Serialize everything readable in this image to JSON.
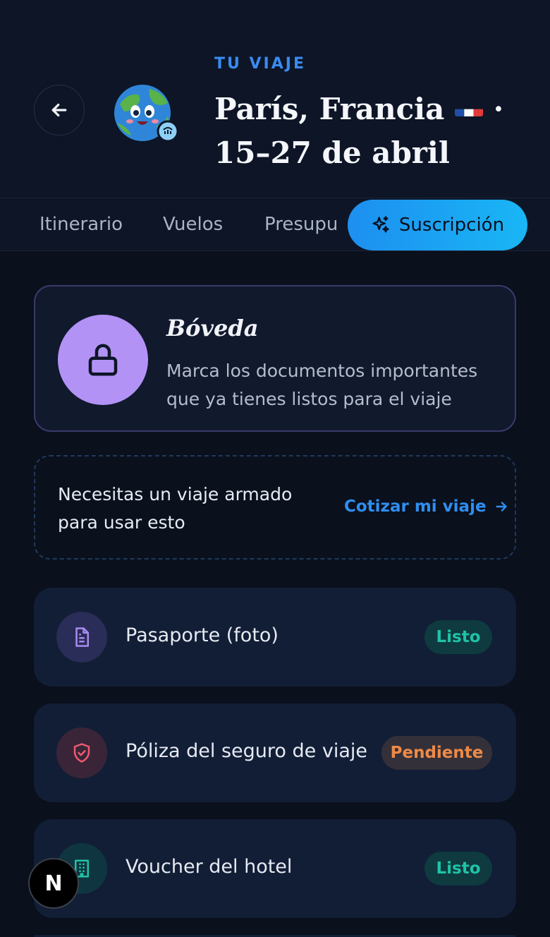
{
  "header": {
    "eyebrow": "TU VIAJE",
    "title": "París, Francia",
    "separator": "·",
    "dates": "15–27 de abril"
  },
  "tabs": [
    {
      "label": "Itinerario"
    },
    {
      "label": "Vuelos"
    },
    {
      "label": "Presupu"
    },
    {
      "label": "Suscripción",
      "active": true
    }
  ],
  "vault": {
    "title": "Bóveda",
    "description": "Marca los documentos importantes que ya tienes listos para el viaje"
  },
  "notice": {
    "text": "Necesitas un viaje armado para usar esto",
    "link": "Cotizar mi viaje"
  },
  "documents": [
    {
      "label": "Pasaporte (foto)",
      "status": "Listo",
      "icon": "document-icon"
    },
    {
      "label": "Póliza del seguro de viaje",
      "status": "Pendiente",
      "icon": "shield-check-icon"
    },
    {
      "label": "Voucher del hotel",
      "status": "Listo",
      "icon": "building-icon"
    }
  ],
  "overlay": {
    "logo": "N"
  },
  "colors": {
    "accent": "#1d8ff0",
    "vault_circle": "#b392f6",
    "ready": "#20c2a6",
    "pending": "#ee8a46"
  }
}
